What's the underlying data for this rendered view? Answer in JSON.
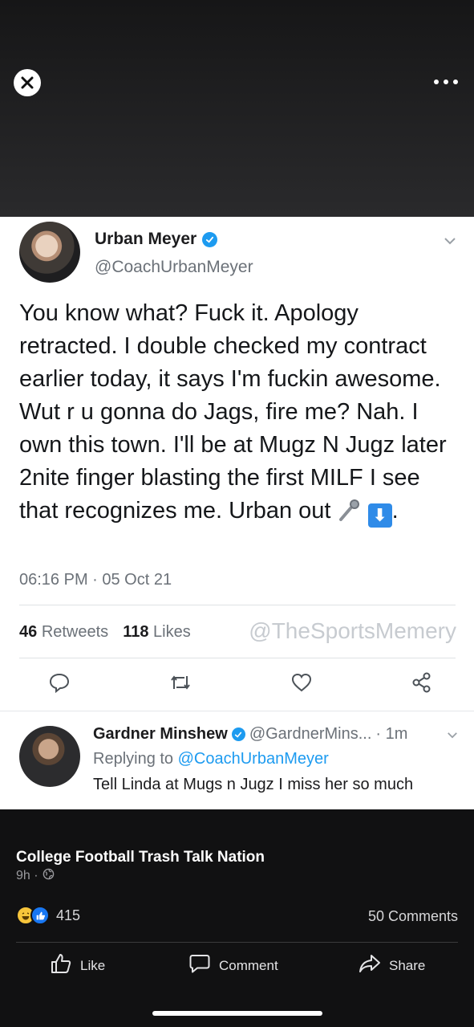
{
  "viewer": {
    "close_icon": "close-icon",
    "more_icon": "more-options-icon"
  },
  "tweet": {
    "author_name": "Urban Meyer",
    "author_handle": "@CoachUrbanMeyer",
    "text_before_emoji": "You know what? Fuck it. Apology retracted. I double checked my contract earlier today, it says I'm fuckin awesome. Wut r u gonna do Jags, fire me? Nah. I own this town. I'll be at Mugz N Jugz later 2nite finger blasting the first MILF I see that recognizes me. Urban out",
    "text_after_emoji": ".",
    "emoji": [
      "microphone",
      "down-arrow"
    ],
    "timestamp": "06:16 PM · 05 Oct 21",
    "retweets_count": "46",
    "retweets_label": "Retweets",
    "likes_count": "118",
    "likes_label": "Likes",
    "watermark": "@TheSportsMemery",
    "accent_color": "#1d9bf0"
  },
  "reply": {
    "author_name": "Gardner Minshew",
    "author_handle": "@GardnerMins...",
    "time": "· 1m",
    "replying_prefix": "Replying to",
    "replying_to": "@CoachUrbanMeyer",
    "text": "Tell Linda at Mugs n Jugz I miss her so much"
  },
  "post": {
    "group_name": "College Football Trash Talk Nation",
    "time_ago": "9h ·",
    "privacy_icon": "globe-icon",
    "reaction_count": "415",
    "comments_label": "50 Comments",
    "actions": {
      "like": "Like",
      "comment": "Comment",
      "share": "Share"
    },
    "brand_color": "#1877f2"
  }
}
